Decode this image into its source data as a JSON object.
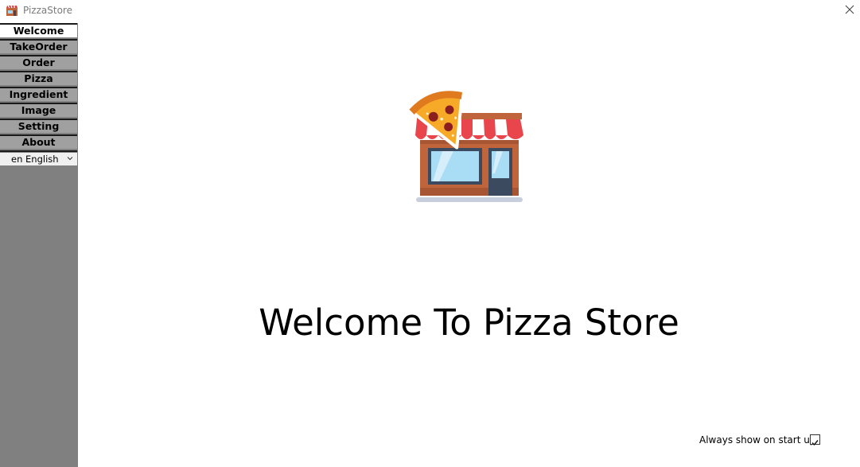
{
  "window": {
    "title": "PizzaStore"
  },
  "sidebar": {
    "items": [
      {
        "label": "Welcome",
        "active": true
      },
      {
        "label": "TakeOrder"
      },
      {
        "label": "Order"
      },
      {
        "label": "Pizza"
      },
      {
        "label": "Ingredient"
      },
      {
        "label": "Image"
      },
      {
        "label": "Setting"
      },
      {
        "label": "About"
      }
    ],
    "language": "en English"
  },
  "main": {
    "heading": "Welcome To Pizza Store",
    "illustration": "pizza-store-icon",
    "startup": {
      "label": "Always show on start up",
      "checked": true
    }
  },
  "colors": {
    "sidebar": "#808080",
    "nav_item": "#a0a0a0",
    "nav_active": "#ffffff"
  }
}
